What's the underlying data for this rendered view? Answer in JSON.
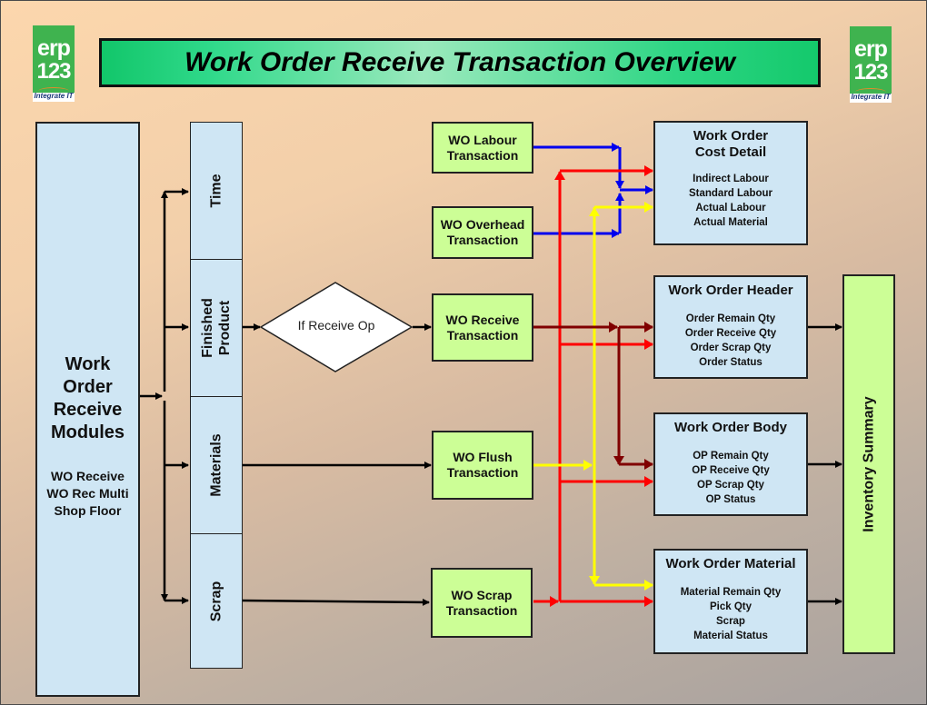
{
  "title": "Work Order Receive Transaction Overview",
  "logo": {
    "line1": "erp",
    "line2": "123",
    "tagline": "Integrate IT"
  },
  "modules": {
    "title_lines": [
      "Work",
      "Order",
      "Receive",
      "Modules"
    ],
    "items": [
      "WO Receive",
      "WO Rec Multi",
      "Shop Floor"
    ]
  },
  "categories": [
    "Time",
    "Finished\nProduct",
    "Materials",
    "Scrap"
  ],
  "decision": "If Receive Op",
  "transactions": {
    "labour": [
      "WO Labour",
      "Transaction"
    ],
    "overhead": [
      "WO Overhead",
      "Transaction"
    ],
    "receive": [
      "WO Receive",
      "Transaction"
    ],
    "flush": [
      "WO Flush",
      "Transaction"
    ],
    "scrap": [
      "WO Scrap",
      "Transaction"
    ]
  },
  "destinations": {
    "cost_detail": {
      "heading": [
        "Work Order",
        "Cost Detail"
      ],
      "items": [
        "Indirect Labour",
        "Standard Labour",
        "Actual Labour",
        "Actual Material"
      ]
    },
    "header": {
      "heading": [
        "Work Order Header"
      ],
      "items": [
        "Order Remain Qty",
        "Order Receive Qty",
        "Order Scrap Qty",
        "Order Status"
      ]
    },
    "body": {
      "heading": [
        "Work Order Body"
      ],
      "items": [
        "OP Remain Qty",
        "OP Receive Qty",
        "OP Scrap Qty",
        "OP Status"
      ]
    },
    "material": {
      "heading": [
        "Work Order Material"
      ],
      "items": [
        "Material Remain Qty",
        "Pick Qty",
        "Scrap",
        "Material Status"
      ]
    }
  },
  "summary": "Inventory Summary",
  "colors": {
    "labour_flow": "#0000ee",
    "scrap_flow": "#ff0000",
    "receive_flow": "#800000",
    "flush_flow": "#ffff00",
    "control_flow": "#000000"
  }
}
